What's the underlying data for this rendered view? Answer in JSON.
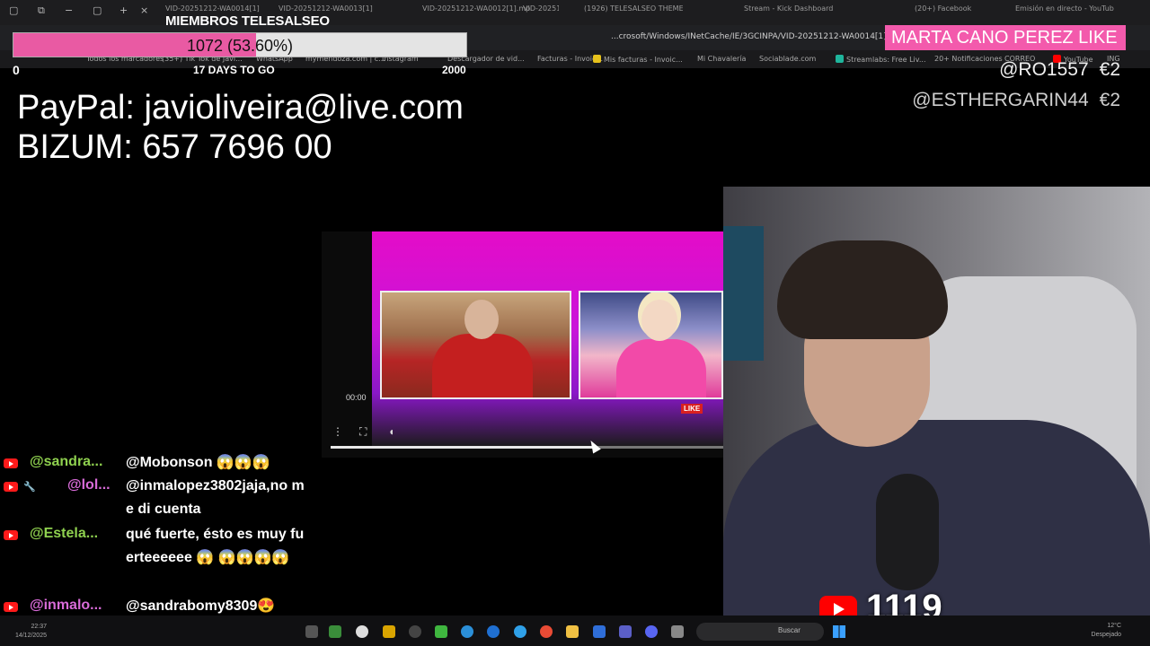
{
  "browser": {
    "tabs": [
      {
        "label": "VID-20251212-WA0014[1]"
      },
      {
        "label": "VID-20251212-WA0013[1]"
      },
      {
        "label": "VID-20251212-WA0012[1].mp4"
      },
      {
        "label": "VID-20251212-WA0011[1]"
      },
      {
        "label": "(1926) TELESALSEO THEME (F..."
      },
      {
        "label": "Stream - Kick Dashboard"
      },
      {
        "label": "(20+) Facebook"
      },
      {
        "label": "Emisión en directo - YouTube"
      }
    ],
    "url": "...crosoft/Windows/INetCache/IE/3GCINPA/VID-20251212-WA0014[1].mp4",
    "bookmarks": [
      "Todos los marcadores",
      "(35+) Tik Tok de Javi...",
      "WhatsApp",
      "mymendoza.com | c...",
      "Instagram",
      "Descargador de vid...",
      "Facturas - Invoic...",
      "Mis facturas - Invoic...",
      "Mi Chavalería",
      "Sociablade.com",
      "Streamlabs: Free Liv...",
      "20+ Notificaciones",
      "CORREO",
      "YouTube",
      "ING"
    ]
  },
  "goal": {
    "title": "MIEMBROS TELESALSEO",
    "progress_text": "1072 (53.60%)",
    "progress_fraction": 0.536,
    "min": "0",
    "days_left": "17 DAYS TO GO",
    "max": "2000"
  },
  "alert": {
    "name_line": "MARTA CANO PEREZ  LIKE"
  },
  "donations": [
    {
      "user": "@RO1557",
      "amount": "€2"
    },
    {
      "user": "@ESTHERGARIN44",
      "amount": "€2"
    }
  ],
  "payment": {
    "paypal": "PayPal: javioliveira@live.com",
    "bizum": "BIZUM: 657 7696 00"
  },
  "player": {
    "time": "00:00",
    "progress_fraction": 0.68,
    "like_badge": "LIKE"
  },
  "chat": [
    {
      "user": "@sandra...",
      "text": "@Mobonson 😱😱😱"
    },
    {
      "user": "@lol...",
      "text": "@inmalopez3802jaja,no me di cuenta"
    },
    {
      "user": "@Estela...",
      "text": "qué fuerte, ésto es muy fuerteeeeee 😱 😱😱😱😱"
    },
    {
      "user": "@inmalo...",
      "text": "@sandrabomy8309😍"
    },
    {
      "user": "",
      "text": "😍"
    }
  ],
  "viewers": {
    "count": "1119"
  },
  "taskbar": {
    "time": "22:37",
    "date": "14/12/2025",
    "search_label": "Buscar",
    "weather_temp": "12°C",
    "weather_desc": "Despejado"
  }
}
